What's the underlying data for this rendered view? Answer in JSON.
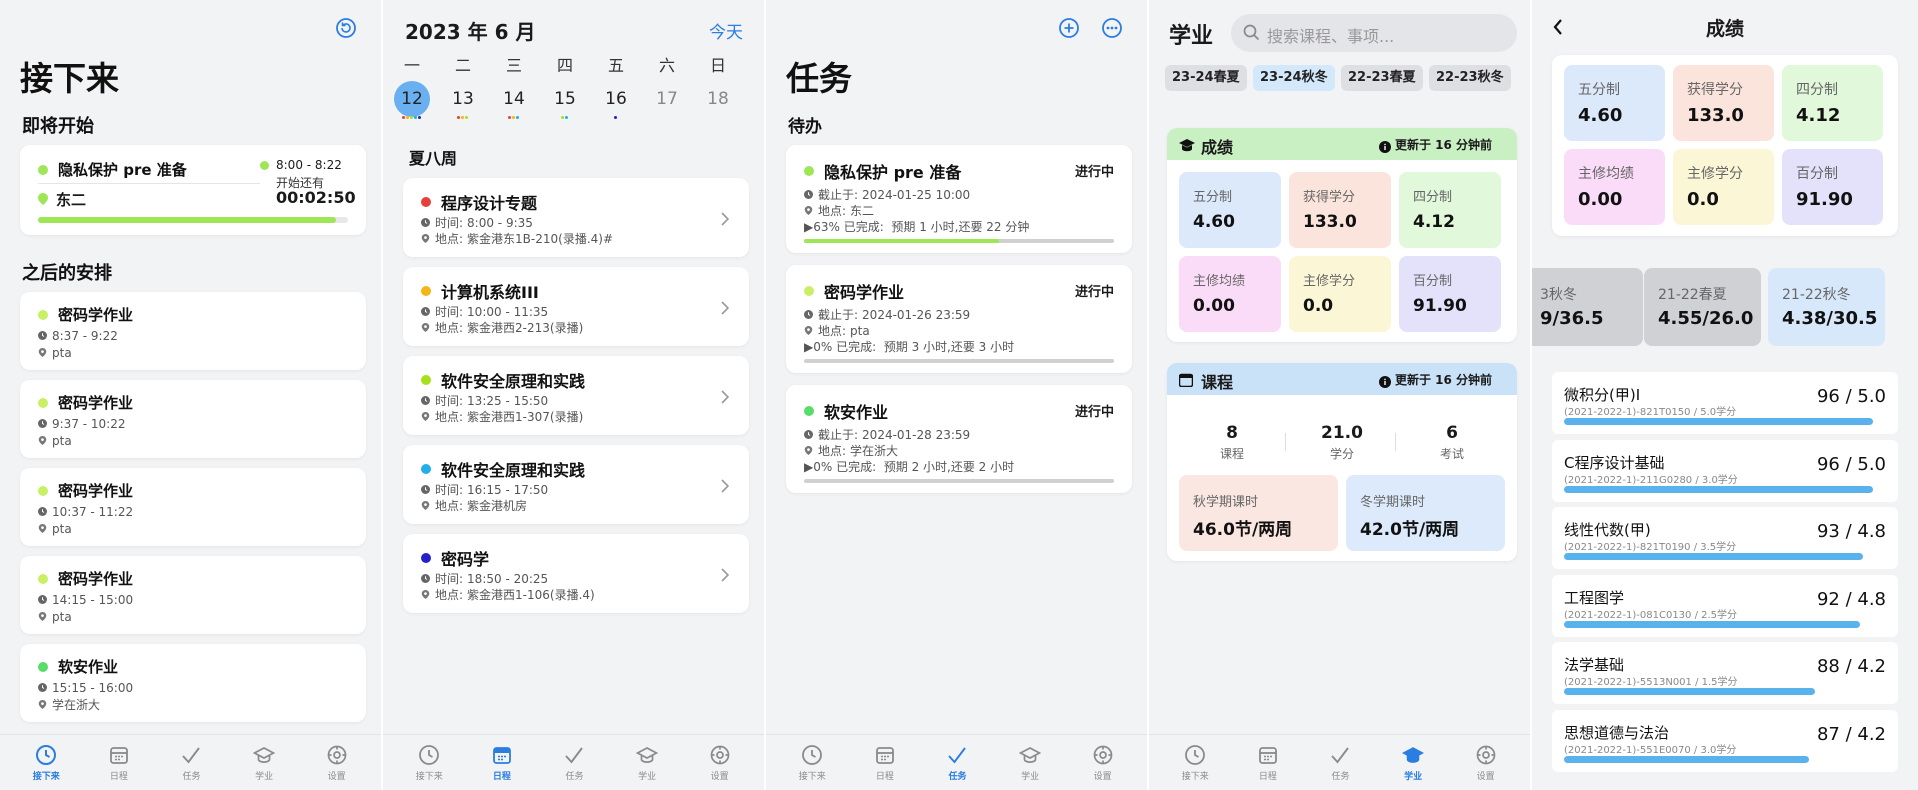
{
  "colors": {
    "accent": "#2a7de1",
    "green": "#9ee655",
    "lightgreen": "#c8ef66",
    "red": "#e5403b",
    "yellow": "#f4b615",
    "cyan": "#22aee6",
    "navy": "#2521c8",
    "progress_blue": "#5ab2ec"
  },
  "nav": [
    {
      "label": "接下来",
      "icon": "clock-icon"
    },
    {
      "label": "日程",
      "icon": "calendar-icon"
    },
    {
      "label": "任务",
      "icon": "check-icon"
    },
    {
      "label": "学业",
      "icon": "graduation-cap-icon"
    },
    {
      "label": "设置",
      "icon": "gear-icon"
    }
  ],
  "upcoming": {
    "title": "接下来",
    "starting_section": "即将开始",
    "now": {
      "name": "隐私保护 pre 准备",
      "place": "东二",
      "time": "8:00 - 8:22",
      "countdown_label": "开始还有",
      "countdown": "00:02:50",
      "progress": 0.96
    },
    "later_section": "之后的安排",
    "items": [
      {
        "name": "密码学作业",
        "time": "8:37 - 9:22",
        "place": "pta",
        "color": "#c8ef66"
      },
      {
        "name": "密码学作业",
        "time": "9:37 - 10:22",
        "place": "pta",
        "color": "#c8ef66"
      },
      {
        "name": "密码学作业",
        "time": "10:37 - 11:22",
        "place": "pta",
        "color": "#c8ef66"
      },
      {
        "name": "密码学作业",
        "time": "14:15 - 15:00",
        "place": "pta",
        "color": "#c8ef66"
      },
      {
        "name": "软安作业",
        "time": "15:15 - 16:00",
        "place": "学在浙大",
        "color": "#58dc6a"
      }
    ]
  },
  "schedule": {
    "month": "2023 年 6 月",
    "today_btn": "今天",
    "weekdays": [
      "一",
      "二",
      "三",
      "四",
      "五",
      "六",
      "日"
    ],
    "days": [
      "12",
      "13",
      "14",
      "15",
      "16",
      "17",
      "18"
    ],
    "week_label": "夏八周",
    "time_prefix": "时间:",
    "place_prefix": "地点:",
    "events": [
      {
        "name": "程序设计专题",
        "time": "8:00 - 9:35",
        "place": "紫金港东1B-210(录播.4)#",
        "color": "#e5403b"
      },
      {
        "name": "计算机系统III",
        "time": "10:00 - 11:35",
        "place": "紫金港西2-213(录播)",
        "color": "#f4b615"
      },
      {
        "name": "软件安全原理和实践",
        "time": "13:25 - 15:50",
        "place": "紫金港西1-307(录播)",
        "color": "#a6e11a"
      },
      {
        "name": "软件安全原理和实践",
        "time": "16:15 - 17:50",
        "place": "紫金港机房",
        "color": "#22aee6"
      },
      {
        "name": "密码学",
        "time": "18:50 - 20:25",
        "place": "紫金港西1-106(录播.4)",
        "color": "#2521c8"
      }
    ]
  },
  "tasks": {
    "title": "任务",
    "section": "待办",
    "deadline_prefix": "截止于:",
    "place_prefix": "地点:",
    "items": [
      {
        "name": "隐私保护 pre 准备",
        "status": "进行中",
        "deadline": "2024-01-25 10:00",
        "place": "东二",
        "progress_text": "▶63% 已完成:  预期 1 小时,还要 22 分钟",
        "progress": 0.63,
        "color": "#9ee655"
      },
      {
        "name": "密码学作业",
        "status": "进行中",
        "deadline": "2024-01-26 23:59",
        "place": "pta",
        "progress_text": "▶0% 已完成:  预期 3 小时,还要 3 小时",
        "progress": 0.0,
        "color": "#c8ef66"
      },
      {
        "name": "软安作业",
        "status": "进行中",
        "deadline": "2024-01-28 23:59",
        "place": "学在浙大",
        "progress_text": "▶0% 已完成:  预期 2 小时,还要 2 小时",
        "progress": 0.0,
        "color": "#58dc6a"
      }
    ]
  },
  "academics": {
    "title": "学业",
    "search_placeholder": "搜索课程、事项...",
    "terms": [
      "23-24春夏",
      "23-24秋冬",
      "22-23春夏",
      "22-23秋冬"
    ],
    "grades_title": "成绩",
    "updated": "更新于 16 分钟前",
    "grade_tiles": [
      {
        "label": "五分制",
        "value": "4.60",
        "bg": "#dce9fb"
      },
      {
        "label": "获得学分",
        "value": "133.0",
        "bg": "#fbe4dc"
      },
      {
        "label": "四分制",
        "value": "4.12",
        "bg": "#e1f8da"
      },
      {
        "label": "主修均绩",
        "value": "0.00",
        "bg": "#fbdcf8"
      },
      {
        "label": "主修学分",
        "value": "0.0",
        "bg": "#fbf6d6"
      },
      {
        "label": "百分制",
        "value": "91.90",
        "bg": "#e4e2fb"
      }
    ],
    "courses_title": "课程",
    "course_stats": [
      {
        "value": "8",
        "label": "课程"
      },
      {
        "value": "21.0",
        "label": "学分"
      },
      {
        "value": "6",
        "label": "考试"
      }
    ],
    "hours": [
      {
        "label": "秋学期课时",
        "value": "46.0节/两周",
        "bg": "#fbe7e1"
      },
      {
        "label": "冬学期课时",
        "value": "42.0节/两周",
        "bg": "#dceafb"
      }
    ]
  },
  "grades": {
    "title": "成绩",
    "tiles": [
      {
        "label": "五分制",
        "value": "4.60",
        "bg": "#dce9fb"
      },
      {
        "label": "获得学分",
        "value": "133.0",
        "bg": "#fbe4dc"
      },
      {
        "label": "四分制",
        "value": "4.12",
        "bg": "#e1f8da"
      },
      {
        "label": "主修均绩",
        "value": "0.00",
        "bg": "#fbdcf8"
      },
      {
        "label": "主修学分",
        "value": "0.0",
        "bg": "#fbf6d6"
      },
      {
        "label": "百分制",
        "value": "91.90",
        "bg": "#e4e2fb"
      }
    ],
    "terms": [
      {
        "label": "3秋冬",
        "value": "9/36.5",
        "bg": "#d0d1d4"
      },
      {
        "label": "21-22春夏",
        "value": "4.55/26.0",
        "bg": "#d0d1d4"
      },
      {
        "label": "21-22秋冬",
        "value": "4.38/30.5",
        "bg": "#d8e8fb"
      }
    ],
    "courses": [
      {
        "name": "微积分(甲)I",
        "code": "(2021-2022-1)-821T0150 / 5.0学分",
        "score": "96 / 5.0",
        "pct": 0.96
      },
      {
        "name": "C程序设计基础",
        "code": "(2021-2022-1)-211G0280 / 3.0学分",
        "score": "96 / 5.0",
        "pct": 0.96
      },
      {
        "name": "线性代数(甲)",
        "code": "(2021-2022-1)-821T0190 / 3.5学分",
        "score": "93 / 4.8",
        "pct": 0.93
      },
      {
        "name": "工程图学",
        "code": "(2021-2022-1)-081C0130 / 2.5学分",
        "score": "92 / 4.8",
        "pct": 0.92
      },
      {
        "name": "法学基础",
        "code": "(2021-2022-1)-5513N001 / 1.5学分",
        "score": "88 / 4.2",
        "pct": 0.78
      },
      {
        "name": "思想道德与法治",
        "code": "(2021-2022-1)-551E0070 / 3.0学分",
        "score": "87 / 4.2",
        "pct": 0.76
      }
    ]
  }
}
